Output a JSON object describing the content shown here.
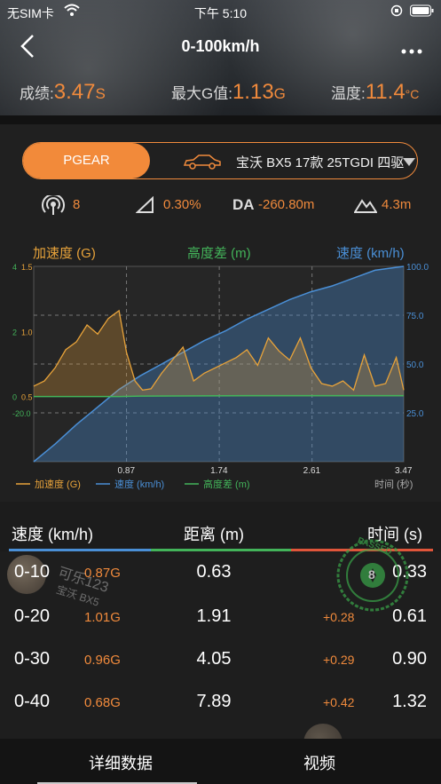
{
  "status_bar": {
    "carrier": "无SIM卡",
    "time": "下午 5:10"
  },
  "nav": {
    "title": "0-100km/h",
    "back_icon": "chevron-left-icon",
    "more_icon": "more-icon"
  },
  "summary": {
    "score_label": "成绩:",
    "score_value": "3.47",
    "score_unit": "S",
    "g_label": "最大G值:",
    "g_value": "1.13",
    "g_unit": "G",
    "temp_label": "温度:",
    "temp_value": "11.4",
    "temp_unit": "°C"
  },
  "selector": {
    "pgear_label": "PGEAR",
    "model": "宝沃 BX5 17款 25TGDI 四驱"
  },
  "metrics": {
    "satellites": "8",
    "slope": "0.30%",
    "da_label": "DA",
    "da_value": "-260.80m",
    "altitude": "4.3m"
  },
  "colors": {
    "accel": "#e8a33a",
    "speed": "#4a8fd6",
    "height": "#43b45a",
    "accent": "#f08a3c"
  },
  "chart_data": {
    "type": "line",
    "series_labels_top": [
      "加速度 (G)",
      "高度差 (m)",
      "速度 (km/h)"
    ],
    "legend": [
      "加速度 (G)",
      "速度 (km/h)",
      "高度差 (m)"
    ],
    "xlabel": "时间 (秒)",
    "x_ticks": [
      "0.87",
      "1.74",
      "2.61",
      "3.47"
    ],
    "xlim": [
      0,
      3.47
    ],
    "accel_axis": {
      "ticks": [
        "1.5",
        "1.0",
        "0.5"
      ],
      "ylim": [
        0.0,
        1.5
      ]
    },
    "height_axis": {
      "ticks": [
        "4",
        "2",
        "0",
        "-20.0"
      ]
    },
    "speed_axis": {
      "ticks": [
        "100.0",
        "75.0",
        "50.0",
        "25.0"
      ],
      "ylim": [
        0,
        100
      ]
    },
    "accel_series": {
      "name": "加速度 (G)",
      "x": [
        0,
        0.1,
        0.2,
        0.3,
        0.4,
        0.5,
        0.6,
        0.7,
        0.8,
        0.87,
        0.95,
        1.02,
        1.1,
        1.2,
        1.3,
        1.4,
        1.5,
        1.6,
        1.7,
        1.8,
        1.9,
        2.0,
        2.1,
        2.2,
        2.3,
        2.4,
        2.5,
        2.6,
        2.7,
        2.8,
        2.9,
        3.0,
        3.1,
        3.2,
        3.3,
        3.4,
        3.47
      ],
      "y": [
        0.58,
        0.62,
        0.72,
        0.86,
        0.92,
        1.05,
        0.98,
        1.1,
        1.16,
        0.84,
        0.62,
        0.55,
        0.56,
        0.68,
        0.78,
        0.88,
        0.62,
        0.68,
        0.72,
        0.76,
        0.8,
        0.86,
        0.74,
        0.95,
        0.85,
        0.78,
        0.95,
        0.72,
        0.6,
        0.58,
        0.62,
        0.55,
        0.82,
        0.58,
        0.6,
        0.8,
        0.55
      ]
    },
    "speed_series": {
      "name": "速度 (km/h)",
      "x": [
        0,
        0.2,
        0.4,
        0.6,
        0.8,
        1.0,
        1.2,
        1.4,
        1.6,
        1.8,
        2.0,
        2.2,
        2.4,
        2.6,
        2.8,
        3.0,
        3.2,
        3.47
      ],
      "y": [
        0,
        9,
        19,
        28,
        37,
        44,
        50,
        56,
        62,
        67,
        73,
        78,
        83,
        87,
        90,
        94,
        98,
        100
      ]
    },
    "height_series": {
      "name": "高度差 (m)",
      "x": [
        0,
        0.5,
        0.8,
        1.0,
        1.5,
        2.0,
        2.5,
        3.0,
        3.47
      ],
      "y": [
        0,
        0,
        0,
        0.3,
        0.4,
        0.5,
        0.5,
        0.5,
        0.5
      ]
    }
  },
  "table": {
    "headers": {
      "speed": "速度 (km/h)",
      "distance": "距离 (m)",
      "time": "时间 (s)"
    },
    "rows": [
      {
        "range": "0-10",
        "g": "0.87G",
        "distance": "0.63",
        "delta": "",
        "time": "0.33"
      },
      {
        "range": "0-20",
        "g": "1.01G",
        "distance": "1.91",
        "delta": "+0.28",
        "time": "0.61"
      },
      {
        "range": "0-30",
        "g": "0.96G",
        "distance": "4.05",
        "delta": "+0.29",
        "time": "0.90"
      },
      {
        "range": "0-40",
        "g": "0.68G",
        "distance": "7.89",
        "delta": "+0.42",
        "time": "1.32"
      }
    ],
    "watermark": {
      "name": "可乐123",
      "car": "宝沃 BX5",
      "stamp_text": "PASSED",
      "stamp_number": "8"
    }
  },
  "tabs": {
    "detail": "详细数据",
    "video": "视频"
  }
}
